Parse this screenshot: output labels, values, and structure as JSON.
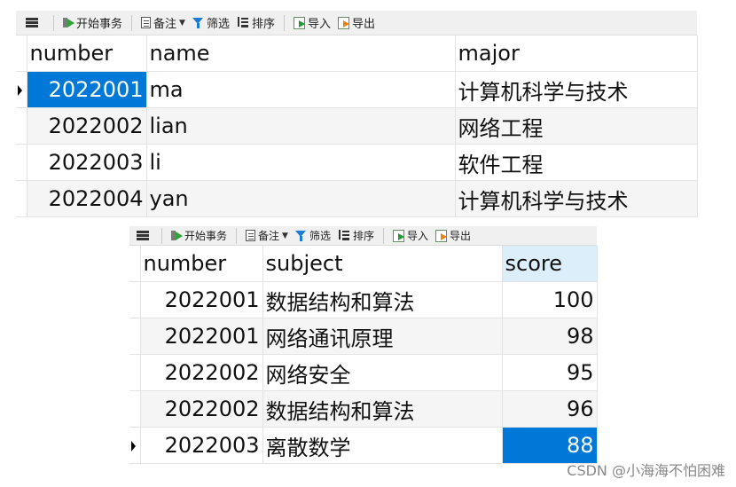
{
  "toolbar": {
    "begin_transaction": "开始事务",
    "note": "备注",
    "filter": "筛选",
    "sort": "排序",
    "import": "导入",
    "export": "导出"
  },
  "students": {
    "columns": [
      "number",
      "name",
      "major"
    ],
    "rows": [
      {
        "number": "2022001",
        "name": "ma",
        "major": "计算机科学与技术"
      },
      {
        "number": "2022002",
        "name": "lian",
        "major": "网络工程"
      },
      {
        "number": "2022003",
        "name": "li",
        "major": "软件工程"
      },
      {
        "number": "2022004",
        "name": "yan",
        "major": "计算机科学与技术"
      }
    ]
  },
  "scores": {
    "columns": [
      "number",
      "subject",
      "score"
    ],
    "rows": [
      {
        "number": "2022001",
        "subject": "数据结构和算法",
        "score": "100"
      },
      {
        "number": "2022001",
        "subject": "网络通讯原理",
        "score": "98"
      },
      {
        "number": "2022002",
        "subject": "网络安全",
        "score": "95"
      },
      {
        "number": "2022002",
        "subject": "数据结构和算法",
        "score": "96"
      },
      {
        "number": "2022003",
        "subject": "离散数学",
        "score": "88"
      }
    ]
  },
  "watermark": "CSDN @小海海不怕困难",
  "colors": {
    "selection": "#0078d7",
    "toolbar_bg": "#f0f0f0"
  }
}
